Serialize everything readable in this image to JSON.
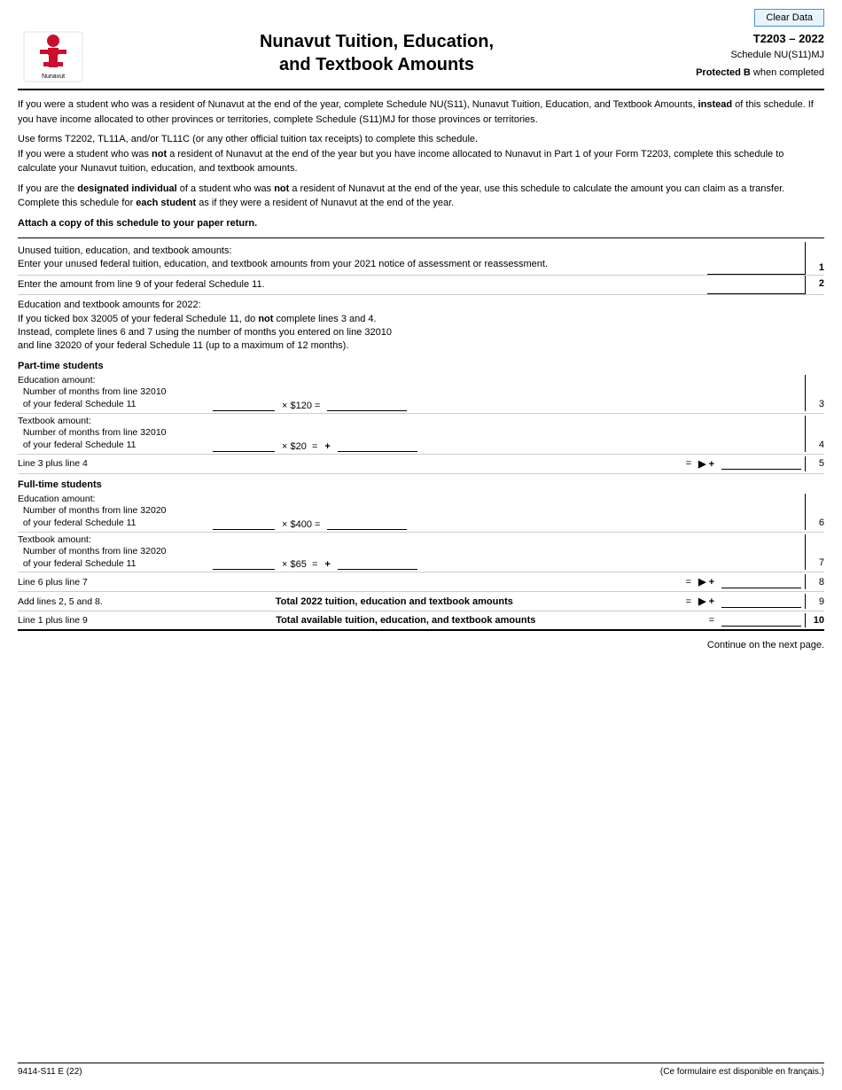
{
  "topBar": {
    "clearDataLabel": "Clear Data"
  },
  "header": {
    "formNumber": "T2203 – 2022",
    "scheduleName": "Schedule NU(S11)MJ",
    "protectedText": "Protected B when completed",
    "formTitle": "Nunavut Tuition, Education,",
    "formTitle2": "and Textbook Amounts",
    "logoAlt": "Nunavut"
  },
  "instructions": {
    "para1": "If you were a student who was a resident of Nunavut at the end of the year, complete Schedule NU(S11), Nunavut Tuition, Education, and Textbook Amounts, instead of this schedule. If you have income allocated to other provinces or territories, complete Schedule (S11)MJ for those provinces or territories.",
    "para1_instead": "instead",
    "para2": "Use forms T2202, TL11A, and/or TL11C (or any other official tuition tax receipts) to complete this schedule.",
    "para3_1": "If you were a student who was ",
    "para3_not": "not",
    "para3_2": " a resident of Nunavut at the end of the year but you have income allocated to Nunavut in Part 1 of your Form T2203, complete this schedule to calculate your Nunavut tuition, education, and textbook amounts.",
    "para4_1": "If you are the ",
    "para4_designated": "designated individual",
    "para4_2": " of a student who was ",
    "para4_not": "not",
    "para4_3": " a resident of Nunavut at the end of the year, use this schedule to calculate the amount you can claim as a transfer. Complete this schedule for ",
    "para4_each": "each student",
    "para4_4": " as if they were a resident of Nunavut at the end of the year.",
    "attachLine": "Attach a copy of this schedule to your paper return."
  },
  "lines": {
    "line1_desc": "Unused tuition, education, and textbook amounts:\nEnter your unused federal tuition, education, and textbook amounts from your 2021 notice of assessment or reassessment.",
    "line1_num": "1",
    "line2_desc": "Enter the amount from line 9 of your federal Schedule 11.",
    "line2_num": "2",
    "edu2022_intro": "Education and textbook amounts for 2022:\nIf you ticked box 32005 of your federal Schedule 11, do not complete lines 3 and 4.\nInstead, complete lines 6 and 7 using the number of months you entered on line 32010\nand line 32020 of your federal Schedule 11 (up to a maximum of 12 months).",
    "edu2022_not": "not",
    "partTimeHeading": "Part-time students",
    "line3_desc": "Education amount:\n  Number of months from line 32010\n  of your federal Schedule 11",
    "line3_rate": "× $120 =",
    "line3_num": "3",
    "line4_desc": "Textbook amount:\n  Number of months from line 32010\n  of your federal Schedule 11",
    "line4_rate": "× $20 =",
    "line4_plus": "+",
    "line4_num": "4",
    "line5_desc": "Line 3 plus line 4",
    "line5_equals": "=",
    "line5_arrow": "▶ +",
    "line5_num": "5",
    "fullTimeHeading": "Full-time students",
    "line6_desc": "Education amount:\n  Number of months from line 32020\n  of your federal Schedule 11",
    "line6_rate": "× $400 =",
    "line6_num": "6",
    "line7_desc": "Textbook amount:\n  Number of months from line 32020\n  of your federal Schedule 11",
    "line7_rate": "× $65 =",
    "line7_plus": "+",
    "line7_num": "7",
    "line8_desc": "Line 6 plus line 7",
    "line8_equals": "=",
    "line8_arrow": "▶ +",
    "line8_num": "8",
    "line9_desc": "Add lines 2, 5 and 8.",
    "line9_total_label": "Total 2022 tuition, education and textbook amounts",
    "line9_equals": "=",
    "line9_arrow": "▶ +",
    "line9_num": "9",
    "line10_desc": "Line 1 plus line 9",
    "line10_total_label": "Total available tuition, education, and textbook amounts",
    "line10_equals": "=",
    "line10_num": "10",
    "continueText": "Continue on the next page."
  },
  "footer": {
    "formCode": "9414-S11 E (22)",
    "frenchNote": "(Ce formulaire est disponible en français.)"
  }
}
